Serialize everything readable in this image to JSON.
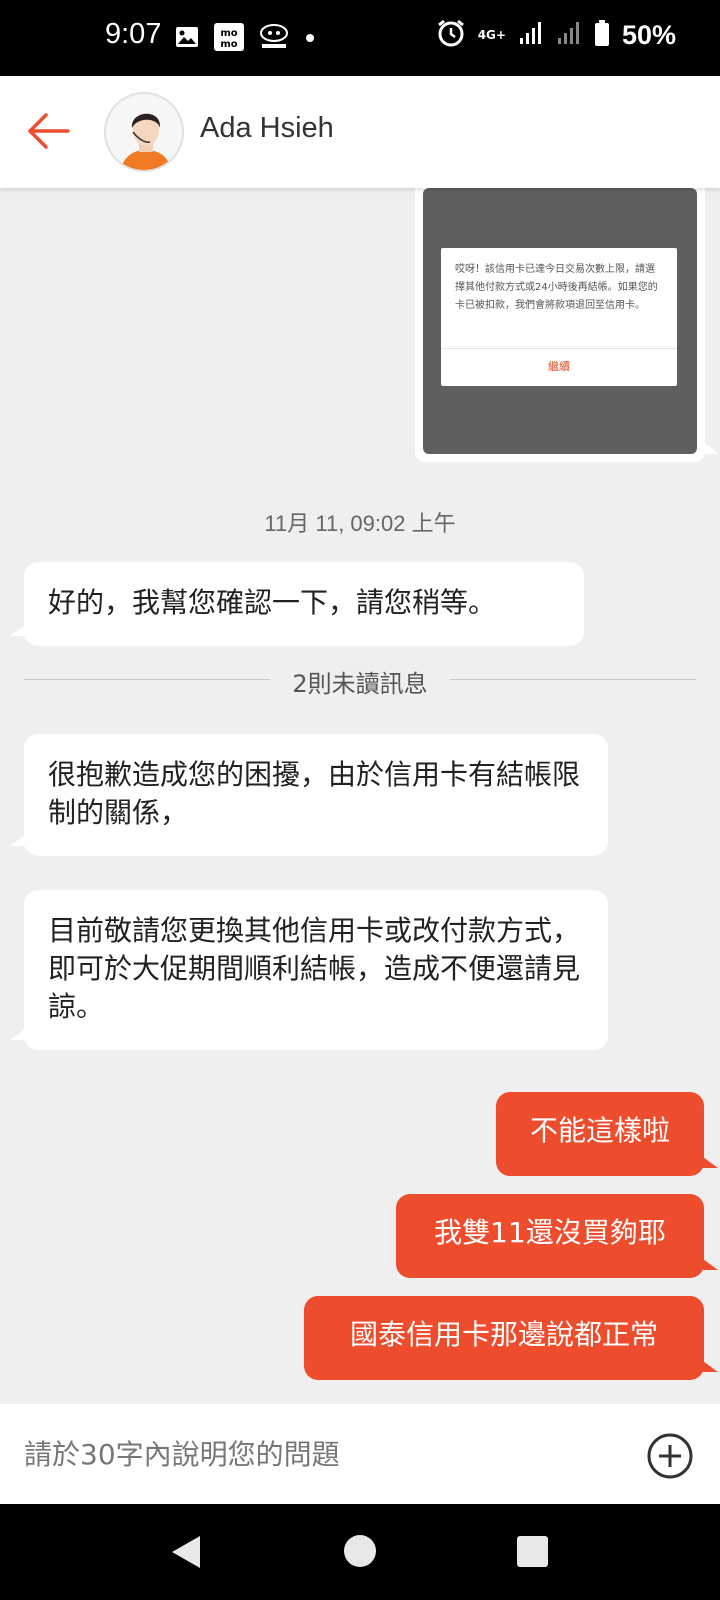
{
  "status_bar": {
    "time": "9:07",
    "network": "4G+",
    "battery": "50%",
    "icons": [
      "image-icon",
      "momo-app-icon",
      "gomaji-app-icon",
      "dot-icon",
      "alarm-icon",
      "signal-icon",
      "battery-icon"
    ]
  },
  "header": {
    "contact_name": "Ada Hsieh"
  },
  "image_message": {
    "dialog_text": "哎呀！該信用卡已達今日交易次數上限，請選擇其他付款方式或24小時後再結帳。如果您的卡已被扣款，我們會將款項退回至信用卡。",
    "dialog_button": "繼續"
  },
  "timestamp": "11月 11, 09:02 上午",
  "unread_divider": "2則未讀訊息",
  "messages_in": [
    "好的，我幫您確認一下，請您稍等。",
    "很抱歉造成您的困擾，由於信用卡有結帳限制的關係，",
    "目前敬請您更換其他信用卡或改付款方式，即可於大促期間順利結帳，造成不便還請見諒。"
  ],
  "messages_out": [
    "不能這樣啦",
    "我雙11還沒買夠耶",
    "國泰信用卡那邊說都正常"
  ],
  "input": {
    "placeholder": "請於30字內說明您的問題",
    "value": ""
  },
  "colors": {
    "accent": "#ee4d2d",
    "chat_background": "#efefef",
    "incoming_bubble": "#ffffff"
  }
}
